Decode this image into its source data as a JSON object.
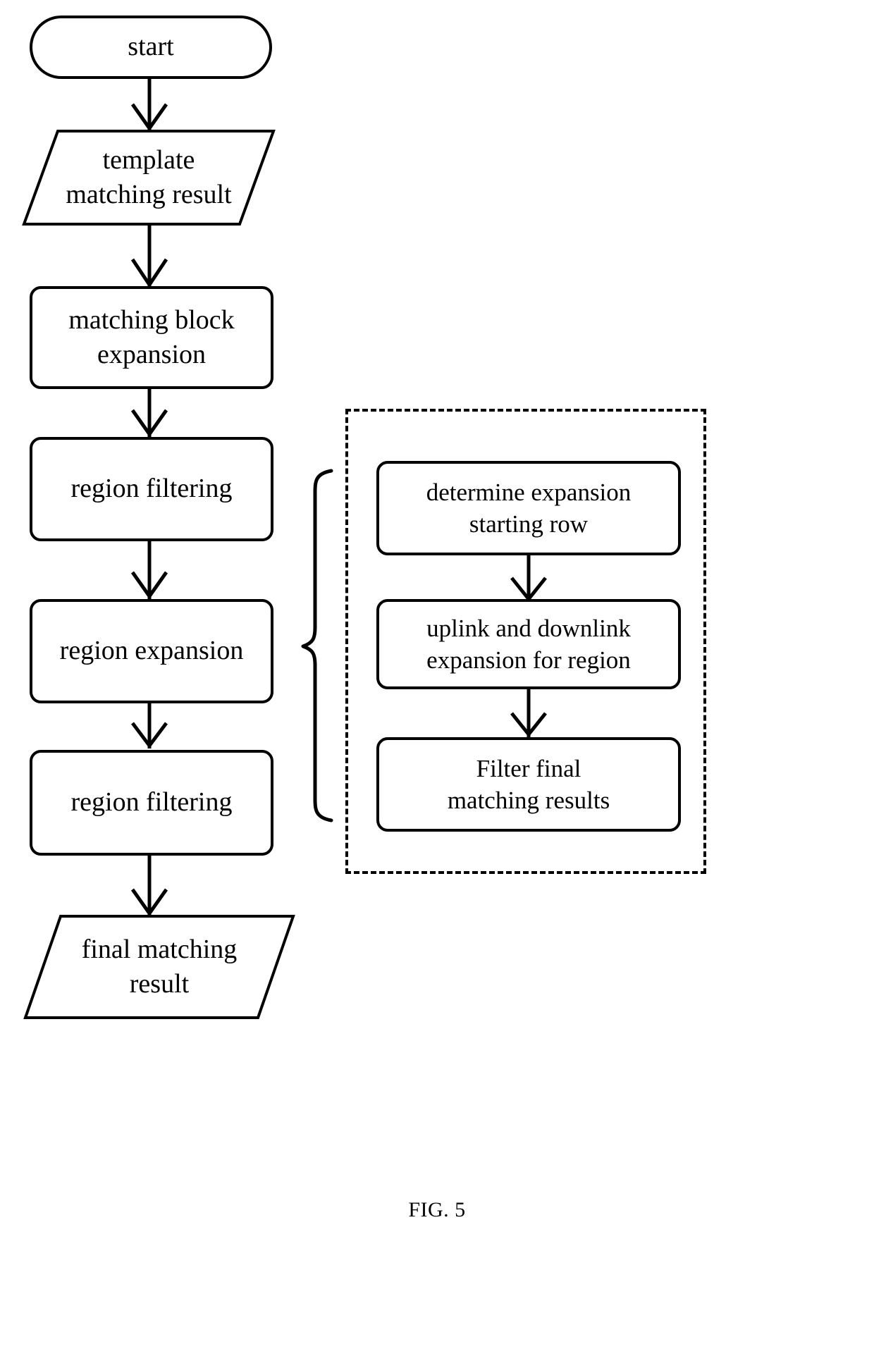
{
  "figure": {
    "caption": "FIG. 5",
    "type": "flowchart",
    "ink_color": "#000000",
    "background_color": "#ffffff"
  },
  "main_flow": {
    "nodes": [
      {
        "id": "start",
        "shape": "stadium",
        "lines": [
          "start"
        ]
      },
      {
        "id": "template_result",
        "shape": "parallelogram",
        "lines": [
          "template",
          "matching result"
        ]
      },
      {
        "id": "block_expansion",
        "shape": "rounded-rect",
        "lines": [
          "matching block",
          "expansion"
        ]
      },
      {
        "id": "region_filter_1",
        "shape": "rounded-rect",
        "lines": [
          "region  filtering"
        ]
      },
      {
        "id": "region_expansion",
        "shape": "rounded-rect",
        "lines": [
          "region expansion"
        ]
      },
      {
        "id": "region_filter_2",
        "shape": "rounded-rect",
        "lines": [
          "region  filtering"
        ]
      },
      {
        "id": "final_result",
        "shape": "parallelogram",
        "lines": [
          "final matching",
          "result"
        ]
      }
    ],
    "edges": [
      {
        "from": "start",
        "to": "template_result",
        "arrow": "open-v"
      },
      {
        "from": "template_result",
        "to": "block_expansion",
        "arrow": "open-v"
      },
      {
        "from": "block_expansion",
        "to": "region_filter_1",
        "arrow": "open-v"
      },
      {
        "from": "region_filter_1",
        "to": "region_expansion",
        "arrow": "open-v"
      },
      {
        "from": "region_expansion",
        "to": "region_filter_2",
        "arrow": "open-v"
      },
      {
        "from": "region_filter_2",
        "to": "final_result",
        "arrow": "open-v"
      }
    ]
  },
  "sub_process": {
    "container_style": "dashed",
    "attached_to": "region_expansion",
    "connector": "curly-brace",
    "nodes": [
      {
        "id": "determine_row",
        "shape": "rounded-rect",
        "lines": [
          "determine expansion",
          "starting row"
        ]
      },
      {
        "id": "updown_expand",
        "shape": "rounded-rect",
        "lines": [
          "uplink and downlink",
          "expansion for region"
        ]
      },
      {
        "id": "filter_final",
        "shape": "rounded-rect",
        "lines": [
          "Filter final",
          "matching results"
        ]
      }
    ],
    "edges": [
      {
        "from": "determine_row",
        "to": "updown_expand",
        "arrow": "open-v"
      },
      {
        "from": "updown_expand",
        "to": "filter_final",
        "arrow": "open-v"
      }
    ]
  }
}
